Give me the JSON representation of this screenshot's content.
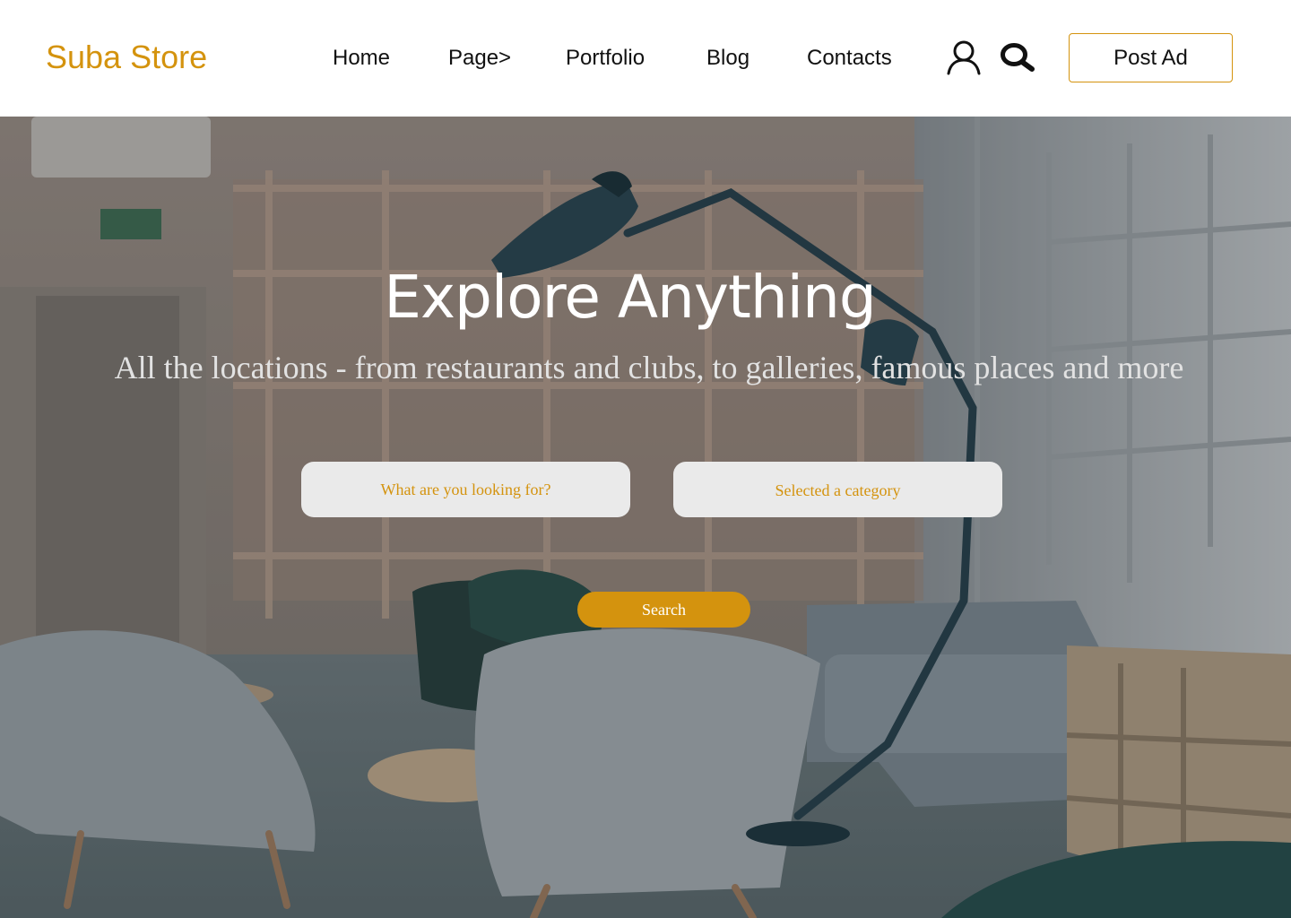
{
  "header": {
    "brand": "Suba Store",
    "nav": {
      "home": "Home",
      "page": "Page>",
      "portfolio": "Portfolio",
      "blog": "Blog",
      "contacts": "Contacts"
    },
    "icons": {
      "account": "user-icon",
      "search": "search-icon"
    },
    "post_ad_label": "Post Ad"
  },
  "hero": {
    "title": "Explore Anything",
    "subtitle": "All the locations - from restaurants and clubs, to galleries, famous places and more",
    "search_placeholder": "What are you looking for?",
    "category_selected": "Selected a category",
    "search_button": "Search"
  },
  "colors": {
    "accent": "#d4930e",
    "text": "#111111",
    "field_bg": "#eaeaea",
    "hero_text": "#ffffff"
  }
}
